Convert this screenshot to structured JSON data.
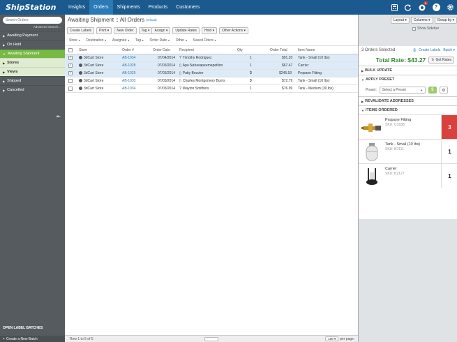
{
  "app": {
    "logo": "ShipStation",
    "nav": [
      "Insights",
      "Orders",
      "Shipments",
      "Products",
      "Customers"
    ],
    "nav_active": 1,
    "notification_count": "3"
  },
  "sidebar": {
    "search_placeholder": "Search Orders",
    "advanced_search": "Advanced Search...",
    "items": [
      {
        "label": "Awaiting Payment"
      },
      {
        "label": "On Hold"
      },
      {
        "label": "Awaiting Shipment"
      },
      {
        "label": "Stores"
      },
      {
        "label": "Views"
      },
      {
        "label": "Shipped"
      },
      {
        "label": "Cancelled"
      }
    ],
    "open_label_batches": "OPEN LABEL BATCHES",
    "create_batch": "Create a New Batch"
  },
  "main": {
    "title": "Awaiting Shipment :: All Orders",
    "reload": "(reload)",
    "toolbar": {
      "create_labels": "Create Labels",
      "print": "Print ▾",
      "new_order": "New Order",
      "tag": "Tag ▾",
      "assign": "Assign ▾",
      "update_rates": "Update Rates",
      "hold": "Hold ▾",
      "other_actions": "Other Actions ▾"
    },
    "view_controls": {
      "layout": "Layout ▾",
      "columns": "Columns ▾",
      "group_by": "Group by ▾"
    },
    "filters": [
      "Store",
      "Destination",
      "Assignee",
      "Tag",
      "Order Date",
      "Other",
      "Saved Filters"
    ],
    "columns": [
      "Store",
      "Order #",
      "Order Date",
      "Recipient",
      "Qty",
      "Order Total",
      "Item Name"
    ],
    "rows": [
      {
        "store": "3dCart Store",
        "order": "AB-1034",
        "date": "07/04/2014",
        "recipient": "Timothy Rodriguez",
        "qty": "1",
        "total": "$91.20",
        "item": "Tank - Small (10 lbs)",
        "checked": "✓",
        "ricon": "?"
      },
      {
        "store": "3dCart Store",
        "order": "AB-1028",
        "date": "07/03/2014",
        "recipient": "Apu Nahasapeemapetilon",
        "qty": "1",
        "total": "$67.47",
        "item": "Carrier",
        "checked": "✓",
        "ricon": "▯"
      },
      {
        "store": "3dCart Store",
        "order": "AB-1029",
        "date": "07/03/2014",
        "recipient": "Patty Bouvier",
        "qty": "3",
        "total": "$245.53",
        "item": "Propane Fitting",
        "checked": "✓",
        "ricon": "▯"
      },
      {
        "store": "3dCart Store",
        "order": "AB-1033",
        "date": "07/03/2014",
        "recipient": "Charles Montgomery Burns",
        "qty": "3",
        "total": "$72.79",
        "item": "Tank - Small (10 lbs)",
        "checked": "",
        "ricon": "▯"
      },
      {
        "store": "3dCart Store",
        "order": "AB-1034",
        "date": "07/03/2014",
        "recipient": "Waylon Smithers",
        "qty": "1",
        "total": "$76.99",
        "item": "Tank - Medium (30 lbs)",
        "checked": "",
        "ricon": "?"
      }
    ],
    "footer": {
      "rows_info": "Row 1 to 5 of 5",
      "per_page_value": "100 ▾",
      "per_page_label": "per page"
    }
  },
  "right": {
    "show_sidebar": "Show Sidebar",
    "selected": "3 Orders Selected",
    "create_labels": "Create Labels",
    "batch": "Batch ▾",
    "total_rate": "Total Rate: $43.27",
    "get_rates": "Get Rates",
    "sections": {
      "bulk_update": "BULK UPDATE",
      "apply_preset": "APPLY PRESET",
      "revalidate": "REVALIDATE ADDRESSES",
      "items_ordered": "ITEMS ORDERED"
    },
    "preset_label": "Preset:",
    "preset_value": "Select a Preset",
    "items": [
      {
        "name": "Propane Fitting",
        "sku": "SKU: C3938",
        "qty": "3"
      },
      {
        "name": "Tank - Small (10 lbs)",
        "sku": "SKU: B2111",
        "qty": "1"
      },
      {
        "name": "Carrier",
        "sku": "SKU: B2127",
        "qty": "1"
      }
    ]
  },
  "colors": {
    "brand": "#1a5a8e",
    "active_green": "#78b944",
    "total_green": "#2e8b2e",
    "alert_red": "#d9413c"
  }
}
